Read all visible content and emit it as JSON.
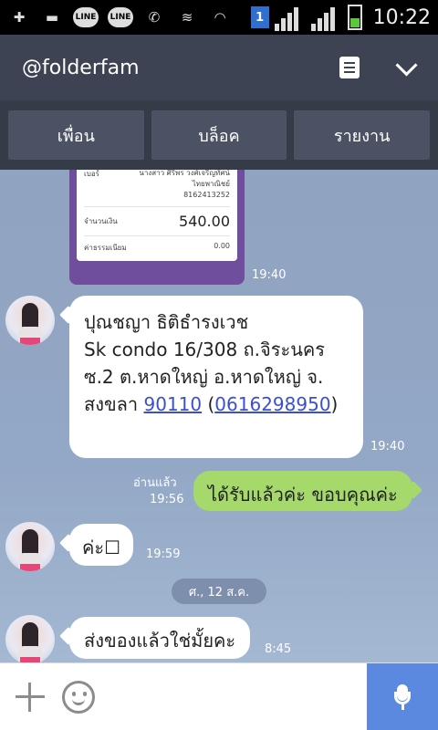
{
  "status_bar": {
    "icons": [
      "plus-box-icon",
      "message-icon",
      "line-app-icon",
      "line-app-icon",
      "phone-icon",
      "vibrate-icon",
      "wifi-icon"
    ],
    "line_label": "LINE",
    "sim": "1",
    "time": "10:22",
    "battery_level": 0.4
  },
  "header": {
    "title": "@folderfam",
    "colors": {
      "header_bg": "#3d4352",
      "bubble_out": "#a5d96b",
      "link": "#3a50d0"
    }
  },
  "actions": [
    "เพื่อน",
    "บล็อค",
    "รายงาน"
  ],
  "slip": {
    "bank_label": "เบอร์",
    "recipient": "นางสาว ศิริพร วงศ์เจริญทัศน์",
    "bank": "ไทยพาณิชย์",
    "account": "8162413252",
    "amount_label": "จำนวนเงิน",
    "amount": "540.00",
    "fee_label": "ค่าธรรมเนียม",
    "fee": "0.00",
    "time": "19:40"
  },
  "messages": [
    {
      "direction": "in",
      "lines": [
        "ปุณชญา ธิติธำรงเวช",
        "",
        "Sk condo 16/308 ถ.จิระนคร",
        "ซ.2 ต.หาดใหญ่ อ.หาดใหญ่ จ.",
        "สงขลา "
      ],
      "postcode": "90110",
      "phone": "0616298950",
      "time": "19:40"
    },
    {
      "direction": "out",
      "text": "ได้รับแล้วค่ะ ขอบคุณค่ะ",
      "read": "อ่านแล้ว",
      "time": "19:56"
    },
    {
      "direction": "in",
      "text": "ค่ะ☐",
      "time": "19:59"
    },
    {
      "direction": "in",
      "text": "ส่งของแล้วใช่มั้ยคะ",
      "time": "8:45"
    }
  ],
  "date_separator": "ศ., 12 ส.ค.",
  "input_bar": {
    "plus_icon": "plus-icon",
    "emoji_icon": "smile-icon",
    "mic_icon": "microphone-icon"
  }
}
